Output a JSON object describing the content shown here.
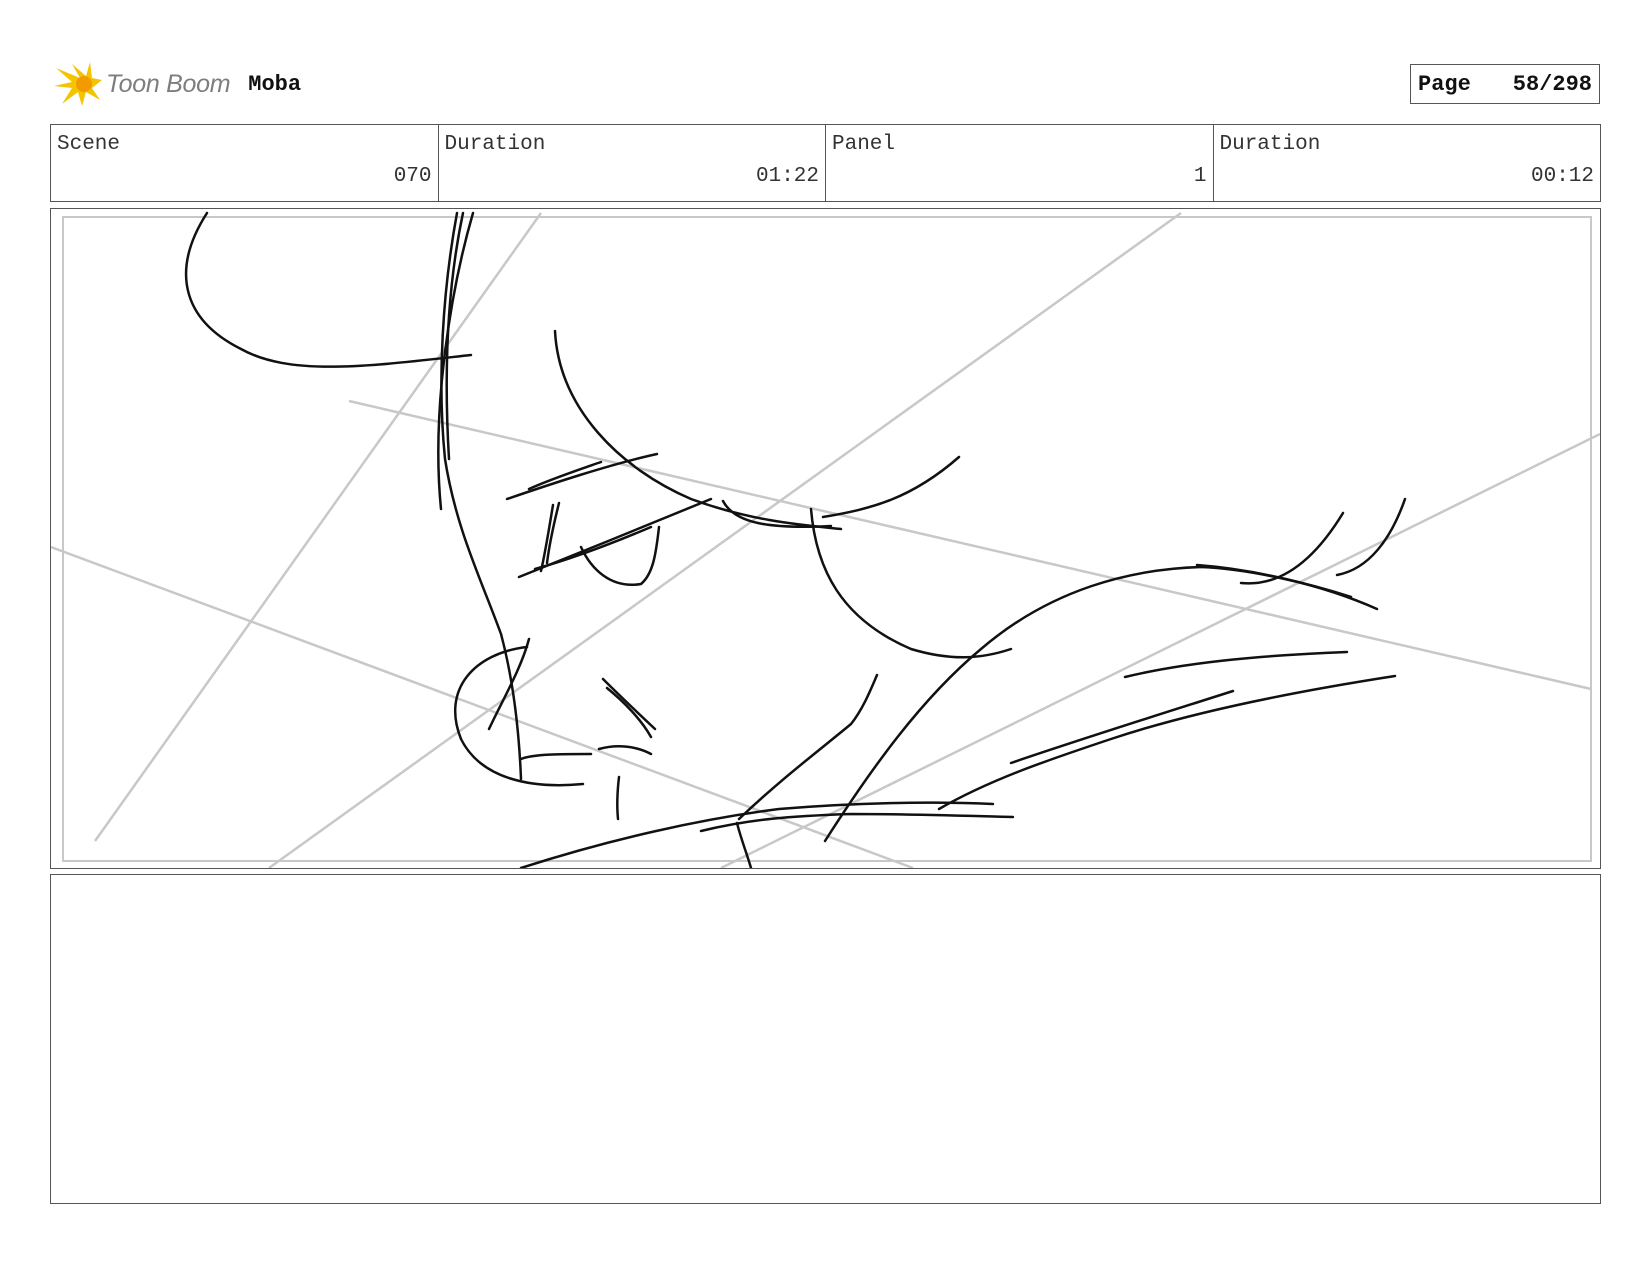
{
  "header": {
    "brand": "Toon Boom",
    "brand_icon": "toon-boom-burst-icon",
    "project_title": "Moba",
    "page_label": "Page",
    "page_number": "58/298"
  },
  "info": {
    "scene_label": "Scene",
    "scene_value": "070",
    "scene_duration_label": "Duration",
    "scene_duration_value": "01:22",
    "panel_label": "Panel",
    "panel_value": "1",
    "panel_duration_label": "Duration",
    "panel_duration_value": "00:12"
  },
  "colors": {
    "logo_yellow": "#f5c400",
    "logo_orange": "#f29a00",
    "sketch_line": "#111111",
    "guide_line": "#c8c8c8",
    "border": "#555555"
  },
  "notes": {
    "text": ""
  }
}
